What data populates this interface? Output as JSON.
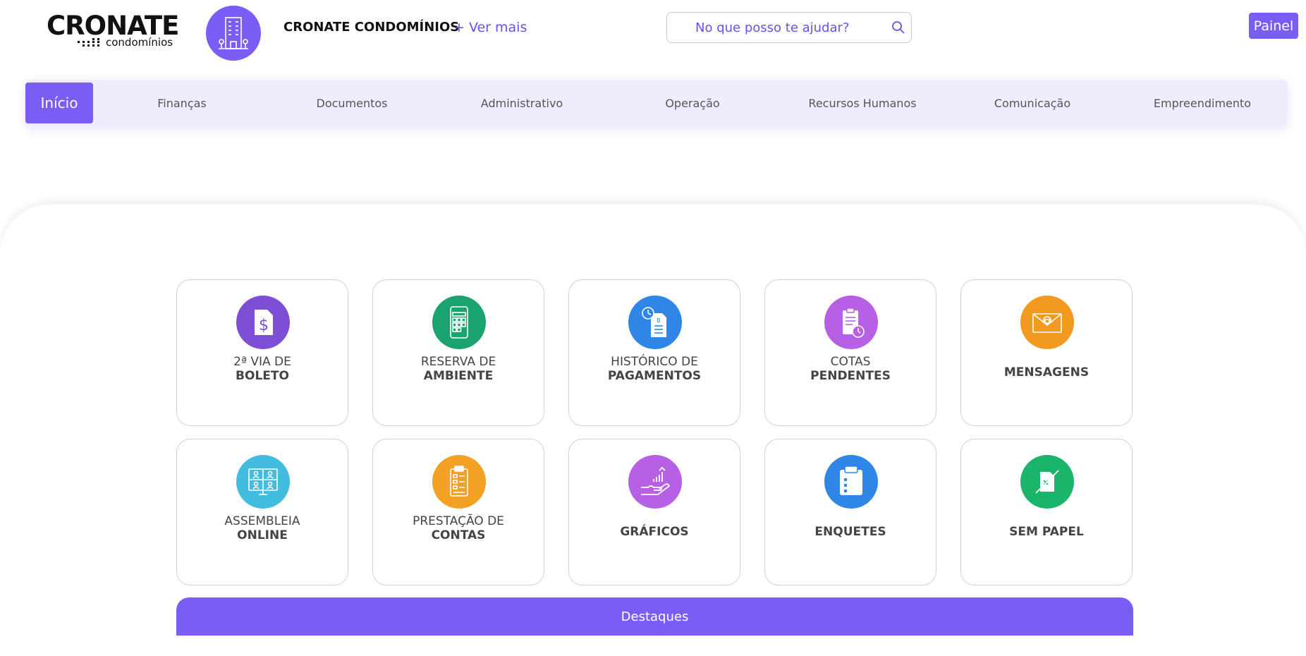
{
  "header": {
    "logo_word": "CRONATE",
    "logo_sub": "condomínios",
    "condo_name": "CRONATE CONDOMÍNIOS",
    "ver_mais": "+ Ver mais",
    "search_placeholder": "No que posso te ajudar?",
    "painel_label": "Painel"
  },
  "nav": {
    "items": [
      {
        "label": "Início",
        "active": true
      },
      {
        "label": "Finanças"
      },
      {
        "label": "Documentos"
      },
      {
        "label": "Administrativo"
      },
      {
        "label": "Operação"
      },
      {
        "label": "Recursos Humanos"
      },
      {
        "label": "Comunicação"
      },
      {
        "label": "Empreendimento"
      }
    ]
  },
  "cards": [
    {
      "line1": "2ª VIA DE",
      "line2": "BOLETO",
      "icon": "boleto-icon",
      "color": "#7c4fd6"
    },
    {
      "line1": "RESERVA DE",
      "line2": "AMBIENTE",
      "icon": "calendar-tablet-icon",
      "color": "#1aa36f"
    },
    {
      "line1": "HISTÓRICO DE",
      "line2": "PAGAMENTOS",
      "icon": "payment-history-icon",
      "color": "#2f86e6"
    },
    {
      "line1": "COTAS",
      "line2": "PENDENTES",
      "icon": "clipboard-clock-icon",
      "color": "#b760e6"
    },
    {
      "single": "MENSAGENS",
      "icon": "envelope-icon",
      "color": "#f29a1f"
    },
    {
      "line1": "ASSEMBLEIA",
      "line2": "ONLINE",
      "icon": "video-meeting-icon",
      "color": "#42bde0"
    },
    {
      "line1": "PRESTAÇÃO DE",
      "line2": "CONTAS",
      "icon": "accounting-clipboard-icon",
      "color": "#f2a124"
    },
    {
      "single": "GRÁFICOS",
      "icon": "chart-hand-icon",
      "color": "#b760e6"
    },
    {
      "single": "ENQUETES",
      "icon": "poll-clipboard-icon",
      "color": "#2f86e6"
    },
    {
      "single": "SEM PAPEL",
      "icon": "no-paper-icon",
      "color": "#1ab56b"
    }
  ],
  "destaques_label": "Destaques"
}
